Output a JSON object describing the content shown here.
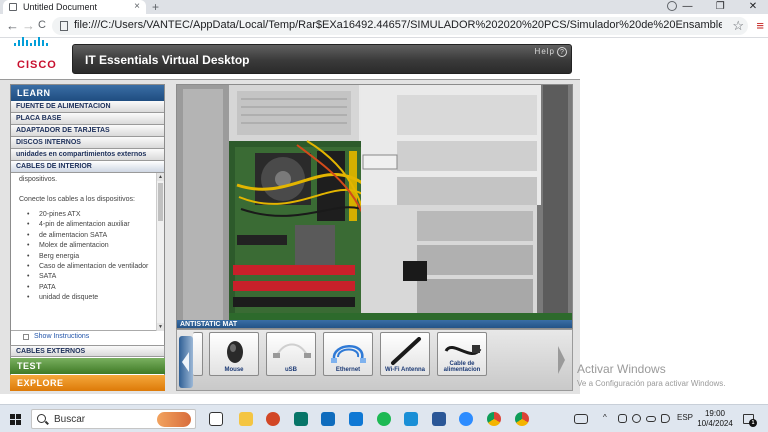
{
  "browser": {
    "tab_title": "Untitled Document",
    "tab_close": "×",
    "new_tab": "+",
    "window_controls": [
      "—",
      "❐",
      "✕"
    ],
    "url": "file:///C:/Users/VANTEC/AppData/Local/Temp/Rar$EXa16492.44657/SIMULADOR%202020%20PCS/Simulador%20de%20Ensamble%20para%20PC'S/Index.htm",
    "nav": {
      "back": "←",
      "forward": "→",
      "reload": "C"
    },
    "star": "☆",
    "menu": "≡"
  },
  "app": {
    "logo_text": "CISCO",
    "title": "IT Essentials Virtual Desktop",
    "help_label": "Help",
    "help_glyph": "?",
    "learn_label": "LEARN",
    "sections": [
      "FUENTE DE ALIMENTACION",
      "PLACA BASE",
      "ADAPTADOR DE TARJETAS",
      "DISCOS INTERNOS",
      "unidades en compartimientos externos",
      "CABLES DE INTERIOR"
    ],
    "content": {
      "intro_tail": "dispositivos.",
      "instruction": "Conecte los cables a los dispositivos:",
      "cables": [
        "20-pines ATX",
        "4-pin de alimentacion auxiliar",
        "de alimentacion SATA",
        "Molex de alimentacion",
        "Berg energia",
        "Caso de alimentacion de ventilador",
        "SATA",
        "PATA",
        "unidad de disquete"
      ]
    },
    "scroll_up": "▲",
    "scroll_down": "▼",
    "show_instructions": "Show Instructions",
    "external_cables": "CABLES EXTERNOS",
    "test_label": "TEST",
    "explore_label": "EXPLORE",
    "mat_label": "ANTISTATIC MAT",
    "tray_items": [
      "Mouse",
      "uSB",
      "Ethernet",
      "Wi-Fi Antenna",
      "Cable de alimentacion"
    ]
  },
  "watermark": {
    "title": "Activar Windows",
    "subtitle": "Ve a Configuración para activar Windows."
  },
  "taskbar": {
    "search_placeholder": "Buscar",
    "language": "ESP",
    "time": "19:00",
    "date": "10/4/2024",
    "notification_count": "1",
    "tray_chevron": "^"
  },
  "colors": {
    "cisco_blue": "#049fd9",
    "cisco_red": "#c8102e",
    "learn_blue": "#1f4d80",
    "test_green": "#3f7a26",
    "explore_orange": "#dd7a08"
  },
  "icons": [
    "file-icon",
    "back-icon",
    "forward-icon",
    "reload-icon",
    "star-icon",
    "menu-icon",
    "help-icon",
    "windows-logo-icon",
    "search-icon",
    "notification-icon"
  ]
}
